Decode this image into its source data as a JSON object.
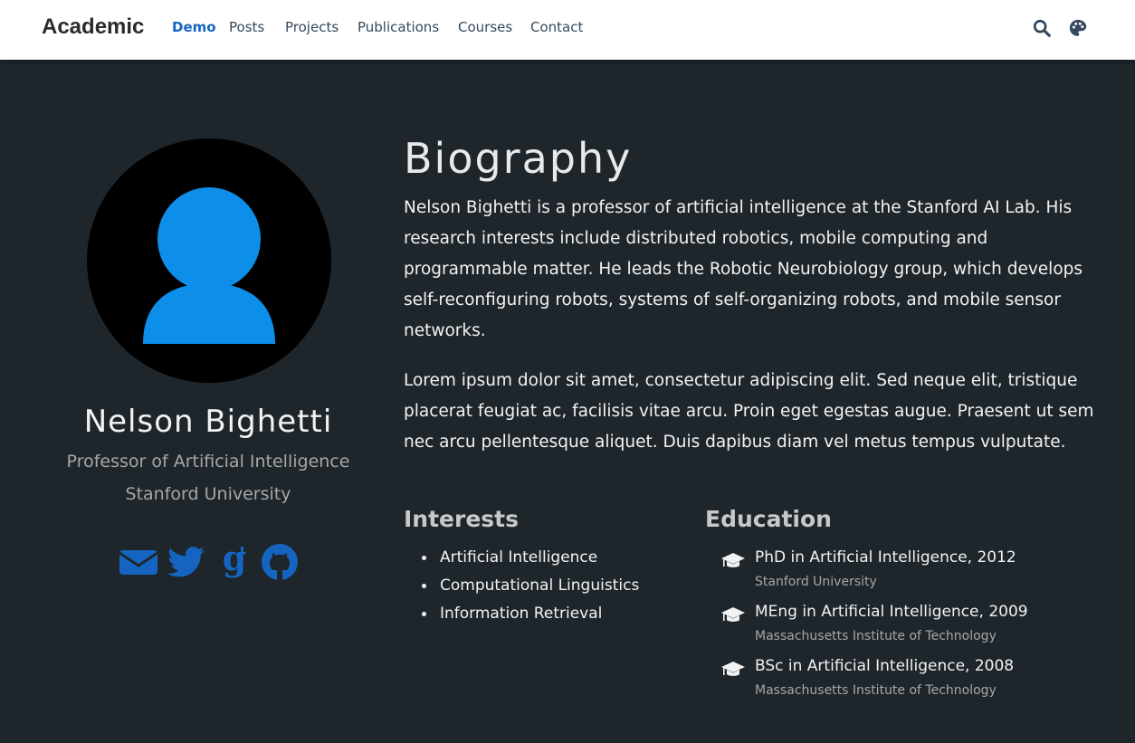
{
  "brand": "Academic",
  "nav": {
    "items": [
      {
        "label": "Demo",
        "active": true
      },
      {
        "label": "Posts"
      },
      {
        "label": "Projects"
      },
      {
        "label": "Publications"
      },
      {
        "label": "Courses"
      },
      {
        "label": "Contact"
      }
    ],
    "icons": [
      "search-icon",
      "palette-icon"
    ]
  },
  "profile": {
    "name": "Nelson Bighetti",
    "role": "Professor of Artificial Intelligence",
    "organization": "Stanford University",
    "avatar_icon": "user-avatar-icon",
    "social": [
      "envelope-icon",
      "twitter-icon",
      "google-scholar-icon",
      "github-icon"
    ]
  },
  "biography": {
    "title": "Biography",
    "paragraphs": [
      "Nelson Bighetti is a professor of artificial intelligence at the Stanford AI Lab. His research interests include distributed robotics, mobile computing and programmable matter. He leads the Robotic Neurobiology group, which develops self-reconfiguring robots, systems of self-organizing robots, and mobile sensor networks.",
      "Lorem ipsum dolor sit amet, consectetur adipiscing elit. Sed neque elit, tristique placerat feugiat ac, facilisis vitae arcu. Proin eget egestas augue. Praesent ut sem nec arcu pellentesque aliquet. Duis dapibus diam vel metus tempus vulputate."
    ]
  },
  "interests": {
    "title": "Interests",
    "items": [
      "Artificial Intelligence",
      "Computational Linguistics",
      "Information Retrieval"
    ]
  },
  "education": {
    "title": "Education",
    "items": [
      {
        "degree": "PhD in Artificial Intelligence, 2012",
        "school": "Stanford University"
      },
      {
        "degree": "MEng in Artificial Intelligence, 2009",
        "school": "Massachusetts Institute of Technology"
      },
      {
        "degree": "BSc in Artificial Intelligence, 2008",
        "school": "Massachusetts Institute of Technology"
      }
    ]
  },
  "colors": {
    "accent": "#1565c0",
    "avatar_figure": "#0d8ee8",
    "background": "#1e262c"
  }
}
